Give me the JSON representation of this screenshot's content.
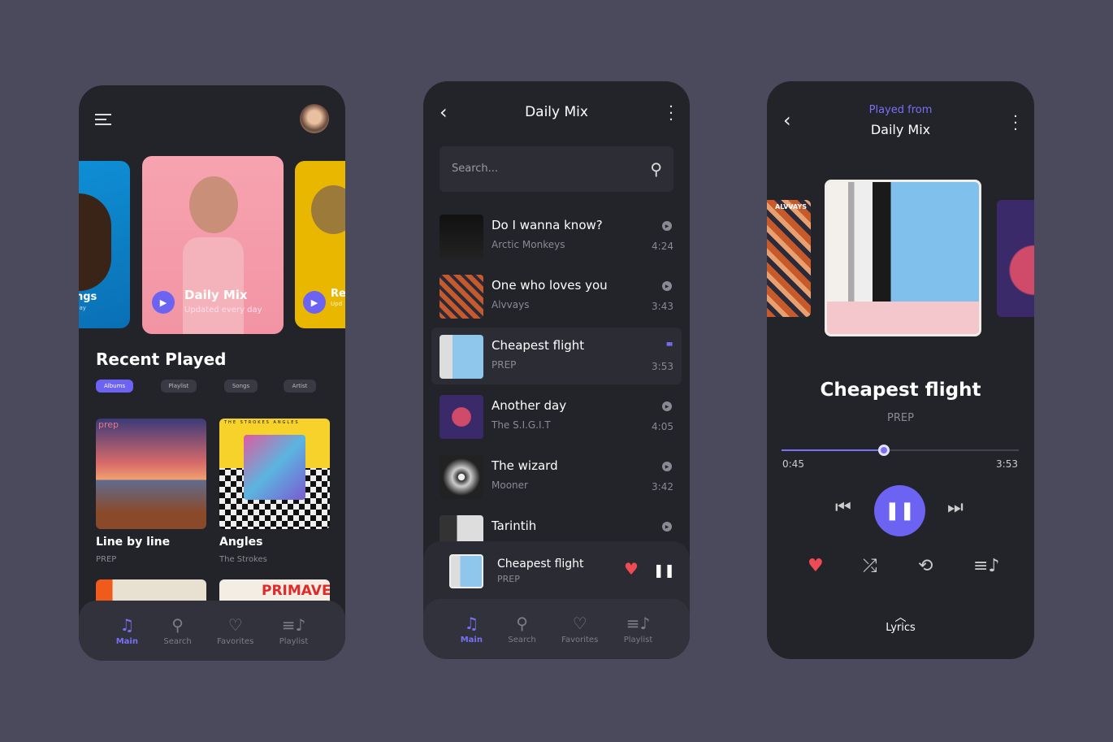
{
  "accent": "#6c63f3",
  "screen1": {
    "cards": [
      {
        "title": "ngs",
        "subtitle": "day"
      },
      {
        "title": "Daily Mix",
        "subtitle": "Updated every day"
      },
      {
        "title": "Re",
        "subtitle": "Upd"
      }
    ],
    "section_title": "Recent Played",
    "chips": [
      "Albums",
      "Playlist",
      "Songs",
      "Artist"
    ],
    "albums": [
      {
        "title": "Line by line",
        "artist": "PREP",
        "art_text": "prep"
      },
      {
        "title": "Angles",
        "artist": "The Strokes",
        "art_text": "THE STROKES ANGLES"
      }
    ],
    "partial_albums": [
      "",
      "PRIMAVERA"
    ]
  },
  "nav": [
    {
      "label": "Main",
      "icon": "music-note-icon"
    },
    {
      "label": "Search",
      "icon": "search-icon"
    },
    {
      "label": "Favorites",
      "icon": "heart-icon"
    },
    {
      "label": "Playlist",
      "icon": "playlist-icon"
    }
  ],
  "screen2": {
    "title": "Daily Mix",
    "search_placeholder": "Search...",
    "tracks": [
      {
        "title": "Do I wanna know?",
        "artist": "Arctic Monkeys",
        "duration": "4:24"
      },
      {
        "title": "One who loves you",
        "artist": "Alvvays",
        "duration": "3:43"
      },
      {
        "title": "Cheapest flight",
        "artist": "PREP",
        "duration": "3:53",
        "playing": true
      },
      {
        "title": "Another day",
        "artist": "The S.I.G.I.T",
        "duration": "4:05"
      },
      {
        "title": "The wizard",
        "artist": "Mooner",
        "duration": "3:42"
      },
      {
        "title": "Tarintih",
        "artist": "",
        "duration": ""
      }
    ],
    "mini_player": {
      "title": "Cheapest flight",
      "artist": "PREP"
    }
  },
  "screen3": {
    "played_from": "Played from",
    "playlist": "Daily Mix",
    "side_art_left": "ALVVAYS",
    "title": "Cheapest flight",
    "artist": "PREP",
    "elapsed": "0:45",
    "total": "3:53",
    "progress": 0.43,
    "lyrics": "Lyrics"
  }
}
